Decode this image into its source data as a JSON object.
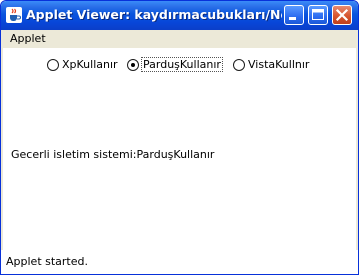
{
  "window": {
    "title": "Applet Viewer: kaydırmacubukları/New...",
    "colors": {
      "titlebar": "#0a55de",
      "close_button": "#d6552f",
      "frame": "#ece9d8"
    }
  },
  "title_buttons": {
    "minimize_icon": "minimize-icon",
    "maximize_icon": "maximize-icon",
    "close_icon": "close-icon"
  },
  "menubar": {
    "items": [
      {
        "label": "Applet"
      }
    ]
  },
  "os_options": [
    {
      "label": "XpKullanır",
      "selected": false
    },
    {
      "label": "ParduşKullanır",
      "selected": true
    },
    {
      "label": "VistaKullnır",
      "selected": false
    }
  ],
  "current_os_text": "Gecerli isletim sistemi:ParduşKullanır",
  "status": {
    "text": "Applet started."
  }
}
